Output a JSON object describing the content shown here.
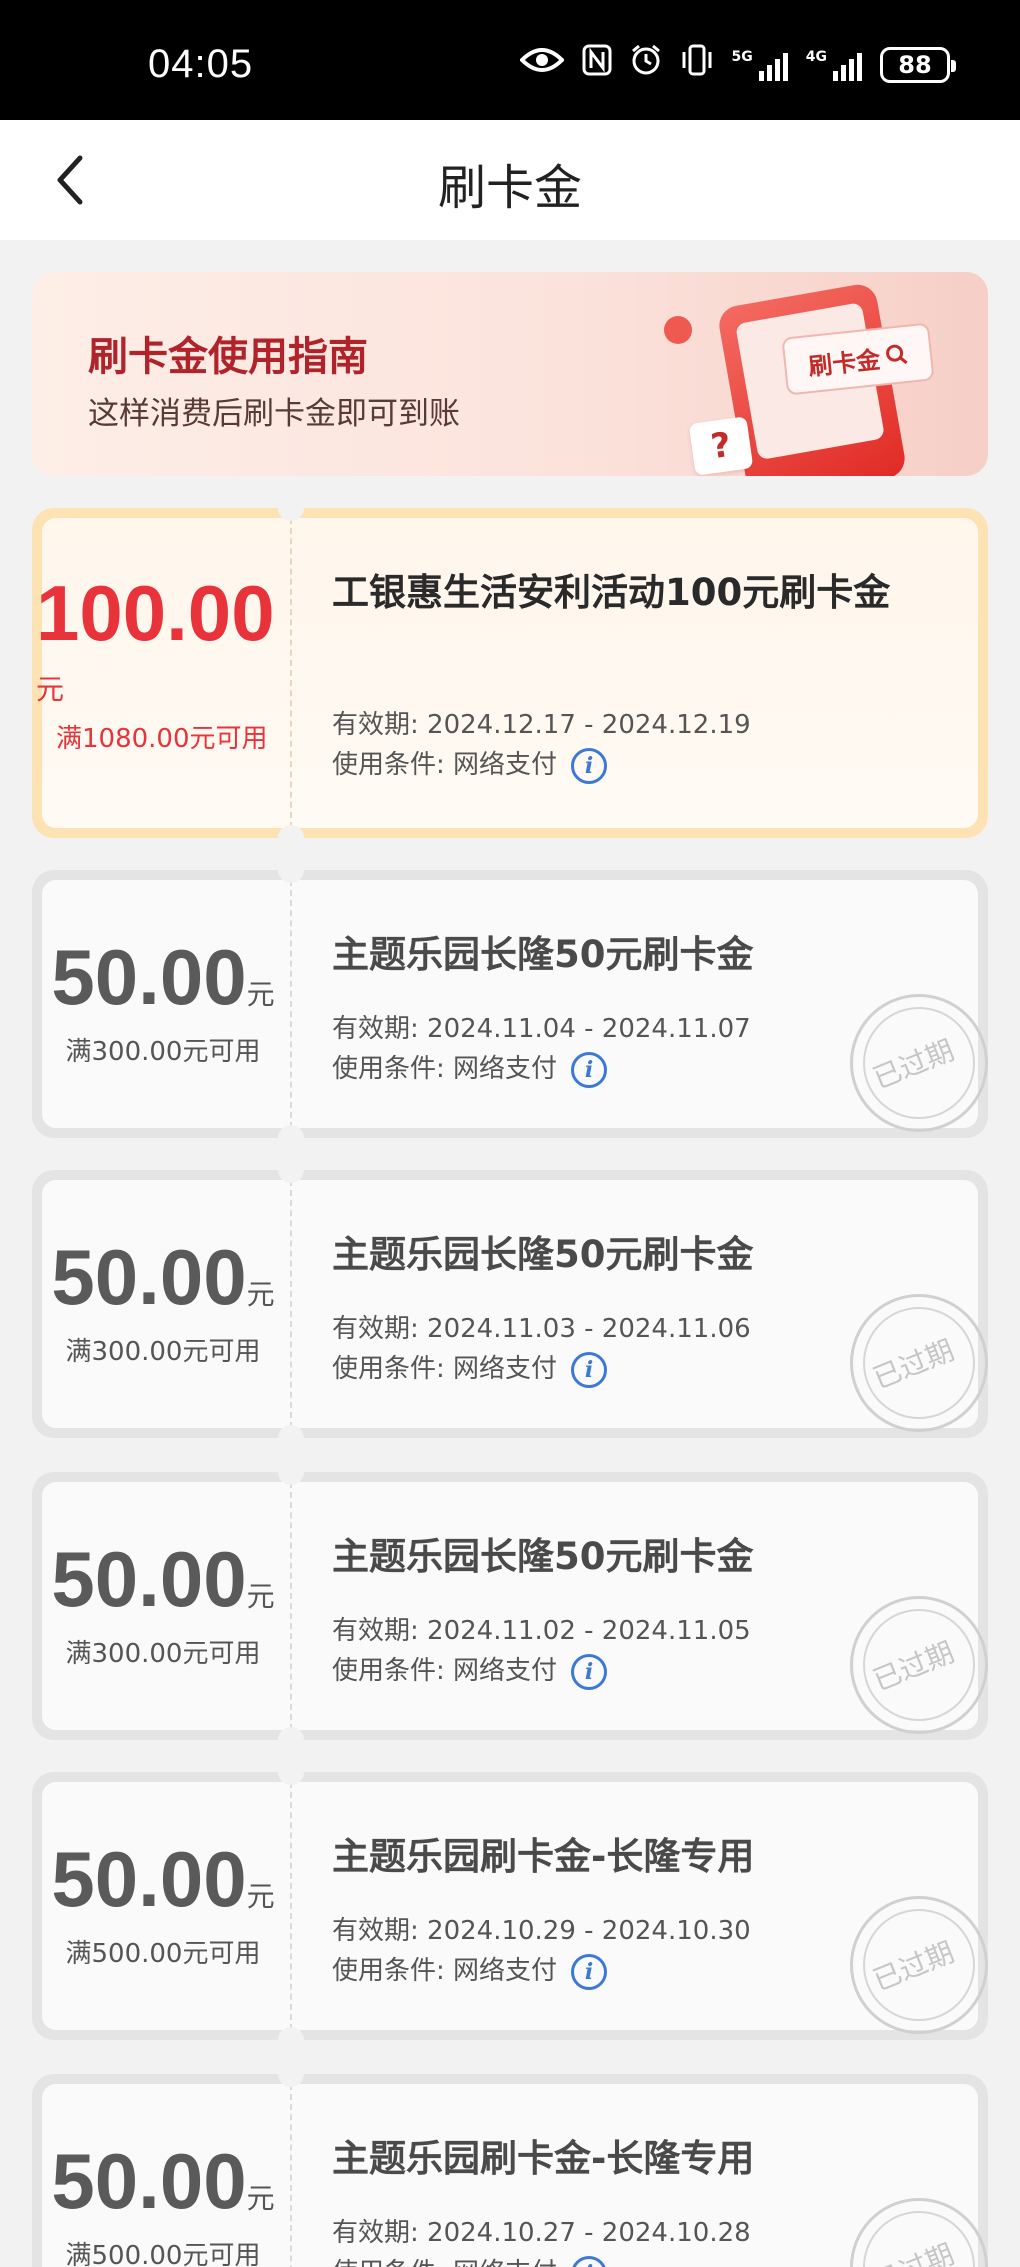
{
  "status_bar": {
    "time": "04:05",
    "network_5g": "5G",
    "network_4g": "4G",
    "battery": "88"
  },
  "header": {
    "title": "刷卡金"
  },
  "guide_banner": {
    "title": "刷卡金使用指南",
    "subtitle": "这样消费后刷卡金即可到账",
    "illustration_search_text": "刷卡金",
    "illustration_question": "?"
  },
  "labels": {
    "validity_prefix": "有效期: ",
    "condition_prefix": "使用条件: ",
    "unit": "元",
    "expired_stamp": "已过期"
  },
  "coupons": [
    {
      "amount": "100.00",
      "unit": "元",
      "threshold": "满1080.00元可用",
      "title": "工银惠生活安利活动100元刷卡金",
      "validity": "有效期: 2024.12.17 - 2024.12.19",
      "condition": "使用条件:  网络支付",
      "status": "active"
    },
    {
      "amount": "50.00",
      "unit": "元",
      "threshold": "满300.00元可用",
      "title": "主题乐园长隆50元刷卡金",
      "validity": "有效期: 2024.11.04 - 2024.11.07",
      "condition": "使用条件:  网络支付",
      "status": "expired"
    },
    {
      "amount": "50.00",
      "unit": "元",
      "threshold": "满300.00元可用",
      "title": "主题乐园长隆50元刷卡金",
      "validity": "有效期: 2024.11.03 - 2024.11.06",
      "condition": "使用条件:  网络支付",
      "status": "expired"
    },
    {
      "amount": "50.00",
      "unit": "元",
      "threshold": "满300.00元可用",
      "title": "主题乐园长隆50元刷卡金",
      "validity": "有效期: 2024.11.02 - 2024.11.05",
      "condition": "使用条件:  网络支付",
      "status": "expired"
    },
    {
      "amount": "50.00",
      "unit": "元",
      "threshold": "满500.00元可用",
      "title": "主题乐园刷卡金-长隆专用",
      "validity": "有效期: 2024.10.29 - 2024.10.30",
      "condition": "使用条件:  网络支付",
      "status": "expired"
    },
    {
      "amount": "50.00",
      "unit": "元",
      "threshold": "满500.00元可用",
      "title": "主题乐园刷卡金-长隆专用",
      "validity": "有效期: 2024.10.27 - 2024.10.28",
      "condition": "使用条件:  网络支付",
      "status": "expired"
    }
  ],
  "colors": {
    "active_amount": "#e8333a",
    "banner_title": "#b0232a",
    "info_icon": "#3c78d8"
  }
}
